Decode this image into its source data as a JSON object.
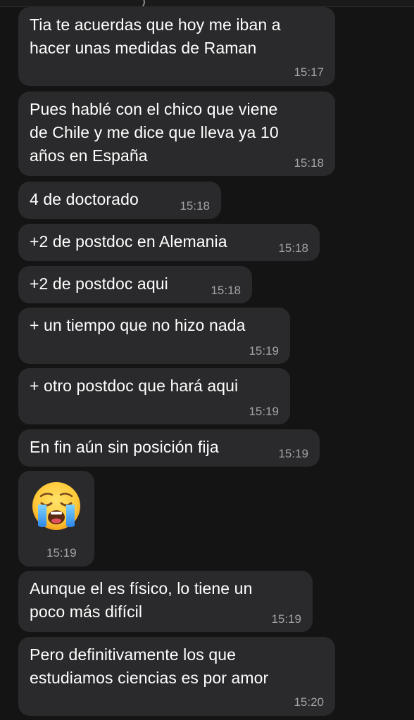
{
  "messages": [
    {
      "text_lines": [
        "Tia te acuerdas que hoy me iban a",
        "hacer unas medidas de Raman"
      ],
      "time": "15:17"
    },
    {
      "text_lines": [
        "Pues hablé con el chico que viene",
        "de Chile y me dice que lleva ya 10",
        "años en España"
      ],
      "time": "15:18"
    },
    {
      "text_lines": [
        "4 de doctorado"
      ],
      "time": "15:18"
    },
    {
      "text_lines": [
        "+2 de postdoc en Alemania"
      ],
      "time": "15:18"
    },
    {
      "text_lines": [
        "+2 de postdoc aqui"
      ],
      "time": "15:18"
    },
    {
      "text_lines": [
        "+ un tiempo que no hizo nada"
      ],
      "time": "15:19"
    },
    {
      "text_lines": [
        "+ otro postdoc que hará aqui"
      ],
      "time": "15:19"
    },
    {
      "text_lines": [
        "En fin aún sin posición fija"
      ],
      "time": "15:19"
    },
    {
      "emoji": "loudly-crying-face",
      "time": "15:19"
    },
    {
      "text_lines": [
        "Aunque el es físico, lo tiene un",
        "poco más difícil"
      ],
      "time": "15:19"
    },
    {
      "text_lines": [
        "Pero definitivamente los que",
        "estudiamos ciencias es por amor"
      ],
      "time": "15:20"
    }
  ],
  "colors": {
    "background": "#141414",
    "bubble": "#2a2a2c",
    "text": "#ffffff",
    "timestamp": "#a3a3a8"
  }
}
